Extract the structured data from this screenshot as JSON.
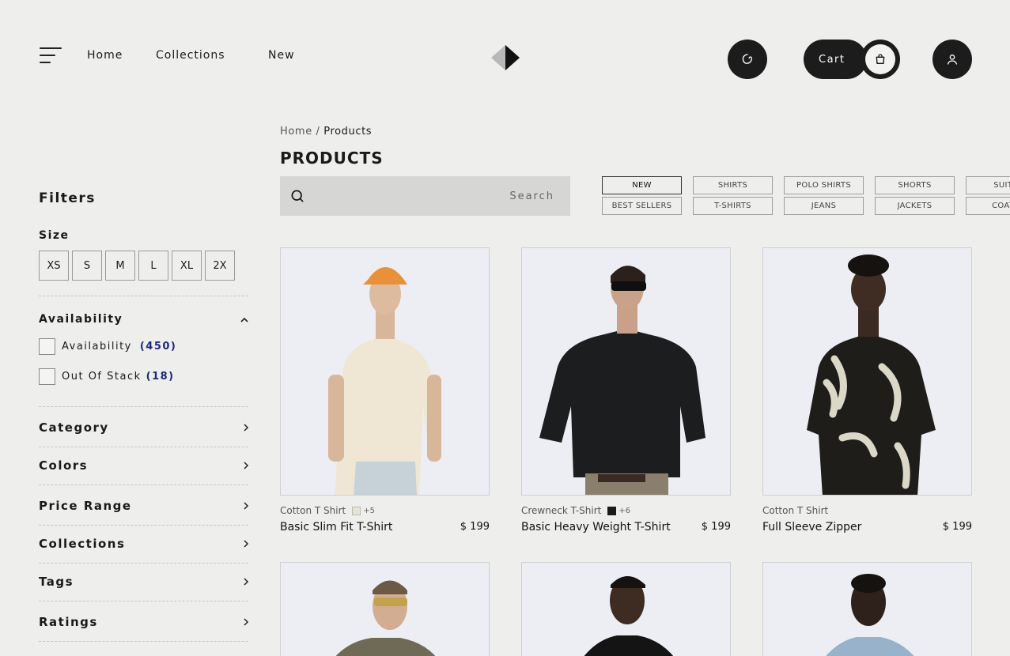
{
  "header": {
    "nav": [
      "Home",
      "Collections",
      "New"
    ],
    "cart_label": "Cart"
  },
  "sidebar": {
    "title": "Filters",
    "size_title": "Size",
    "sizes": [
      "XS",
      "S",
      "M",
      "L",
      "XL",
      "2X"
    ],
    "availability_title": "Availability",
    "availability_options": [
      {
        "label": "Availability",
        "count": "(450)"
      },
      {
        "label": "Out Of Stack",
        "count": "(18)"
      }
    ],
    "sections": [
      "Category",
      "Colors",
      "Price Range",
      "Collections",
      "Tags",
      "Ratings"
    ]
  },
  "main": {
    "breadcrumb": {
      "home": "Home",
      "sep": "/",
      "current": "Products"
    },
    "title": "PRODUCTS",
    "search_placeholder": "Search",
    "chips": [
      [
        "NEW",
        "BEST SELLERS"
      ],
      [
        "SHIRTS",
        "T-SHIRTS"
      ],
      [
        "POLO SHIRTS",
        "JEANS"
      ],
      [
        "SHORTS",
        "JACKETS"
      ],
      [
        "SUITS",
        "COATS"
      ]
    ],
    "products": [
      {
        "category": "Cotton T Shirt",
        "swatch": "#e8e3d3",
        "more": "+5",
        "name": "Basic Slim Fit T-Shirt",
        "price": "$ 199"
      },
      {
        "category": "Crewneck T-Shirt",
        "swatch": "#1a1a1a",
        "more": "+6",
        "name": "Basic Heavy Weight T-Shirt",
        "price": "$ 199"
      },
      {
        "category": "Cotton T Shirt",
        "name": "Full Sleeve Zipper",
        "price": "$ 199"
      }
    ]
  },
  "colors": {
    "dark": "#1c1c1c",
    "accent_count": "#1a2a7a",
    "bg": "#eeeeec"
  }
}
